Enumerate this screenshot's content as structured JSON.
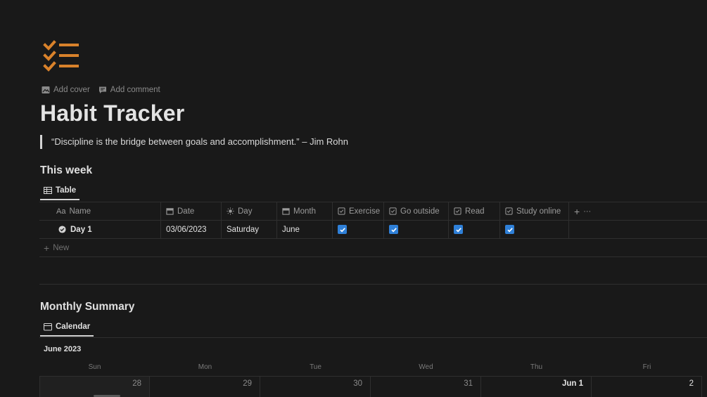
{
  "page": {
    "icon": "checklist-icon",
    "title": "Habit Tracker",
    "quote": "“Discipline is the bridge between goals and accomplishment.” – Jim Rohn",
    "accent_color": "#d9822b"
  },
  "meta": {
    "add_cover": "Add cover",
    "add_comment": "Add comment"
  },
  "this_week": {
    "heading": "This week",
    "view_tab": "Table",
    "columns": [
      {
        "label": "Name",
        "prefix": "Aa",
        "icon": "text-icon"
      },
      {
        "label": "Date",
        "icon": "calendar-icon"
      },
      {
        "label": "Day",
        "icon": "sun-icon"
      },
      {
        "label": "Month",
        "icon": "calendar-icon"
      },
      {
        "label": "Exercise",
        "icon": "checkbox-icon"
      },
      {
        "label": "Go outside",
        "icon": "checkbox-icon"
      },
      {
        "label": "Read",
        "icon": "checkbox-icon"
      },
      {
        "label": "Study online",
        "icon": "checkbox-icon"
      }
    ],
    "add_column": "+",
    "more": "···",
    "rows": [
      {
        "name": "Day 1",
        "date": "03/06/2023",
        "day": "Saturday",
        "month": "June",
        "exercise": true,
        "go_outside": true,
        "read": true,
        "study_online": true
      }
    ],
    "new_label": "New",
    "checkbox_color": "#2f80d8"
  },
  "monthly_summary": {
    "heading": "Monthly Summary",
    "view_tab": "Calendar",
    "month_label": "June 2023",
    "weekdays": [
      "Sun",
      "Mon",
      "Tue",
      "Wed",
      "Thu",
      "Fri"
    ],
    "first_week": [
      "28",
      "29",
      "30",
      "31",
      "Jun 1",
      "2"
    ]
  }
}
